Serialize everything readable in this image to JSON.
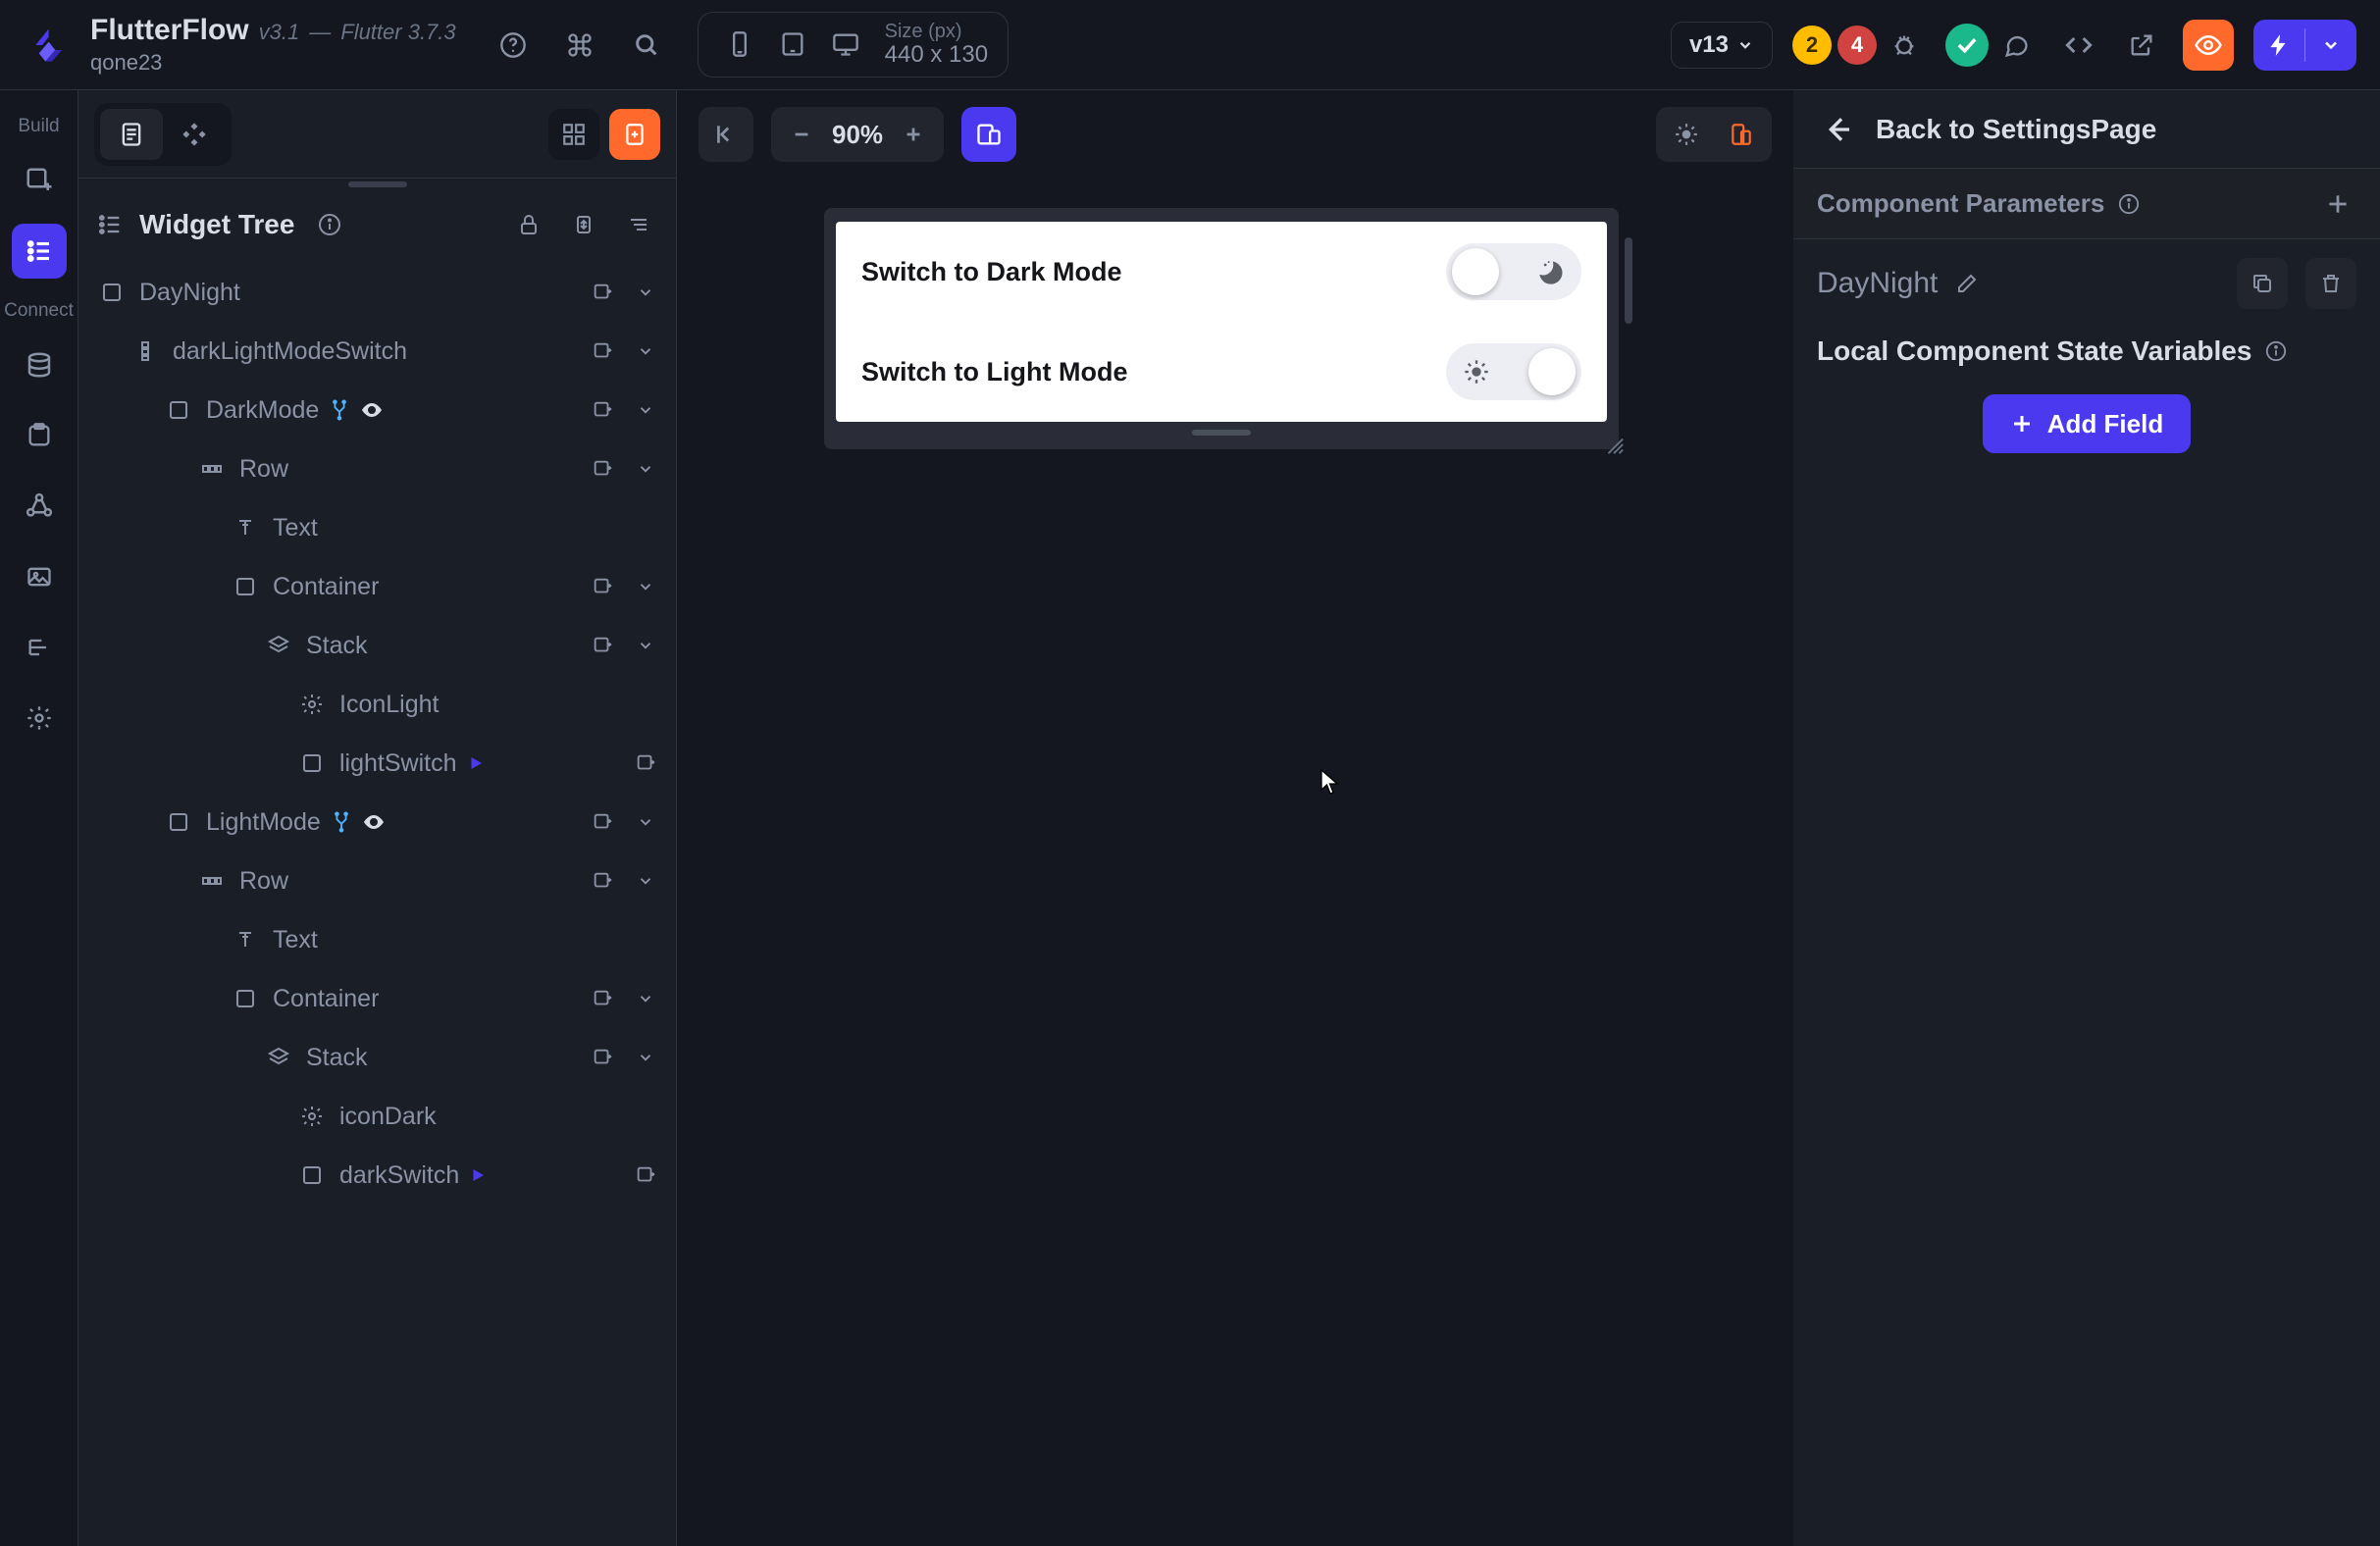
{
  "app": {
    "brand": "FlutterFlow",
    "version": "v3.1",
    "dash": "—",
    "flutter": "Flutter 3.7.3",
    "owner": "qone23"
  },
  "devicebar": {
    "size_label": "Size (px)",
    "size_value": "440 x 130"
  },
  "toolbar_right": {
    "version_pill": "v13",
    "warnings_count": "2",
    "errors_count": "4"
  },
  "rail": {
    "build": "Build",
    "connect": "Connect"
  },
  "widget_tree": {
    "title": "Widget Tree",
    "items": [
      {
        "name": "DayNight",
        "depth": 0,
        "icon": "box",
        "actions": true,
        "chev": true
      },
      {
        "name": "darkLightModeSwitch",
        "depth": 1,
        "icon": "column",
        "actions": true,
        "chev": true
      },
      {
        "name": "DarkMode",
        "depth": 2,
        "icon": "box",
        "cond": true,
        "eye": true,
        "actions": true,
        "chev": true
      },
      {
        "name": "Row",
        "depth": 3,
        "icon": "row",
        "actions": true,
        "chev": true
      },
      {
        "name": "Text",
        "depth": 4,
        "icon": "text"
      },
      {
        "name": "Container",
        "depth": 4,
        "icon": "box",
        "actions": true,
        "chev": true
      },
      {
        "name": "Stack",
        "depth": 5,
        "icon": "stack",
        "actions": true,
        "chev": true
      },
      {
        "name": "IconLight",
        "depth": 6,
        "icon": "gear"
      },
      {
        "name": "lightSwitch",
        "depth": 6,
        "icon": "box",
        "play": true,
        "actions": true
      },
      {
        "name": "LightMode",
        "depth": 2,
        "icon": "box",
        "cond": true,
        "eye": true,
        "actions": true,
        "chev": true
      },
      {
        "name": "Row",
        "depth": 3,
        "icon": "row",
        "actions": true,
        "chev": true
      },
      {
        "name": "Text",
        "depth": 4,
        "icon": "text"
      },
      {
        "name": "Container",
        "depth": 4,
        "icon": "box",
        "actions": true,
        "chev": true
      },
      {
        "name": "Stack",
        "depth": 5,
        "icon": "stack",
        "actions": true,
        "chev": true
      },
      {
        "name": "iconDark",
        "depth": 6,
        "icon": "gear"
      },
      {
        "name": "darkSwitch",
        "depth": 6,
        "icon": "box",
        "play": true,
        "actions": true
      }
    ]
  },
  "canvas": {
    "zoom": "90%",
    "row1": "Switch to Dark Mode",
    "row2": "Switch to Light Mode"
  },
  "rightpanel": {
    "back": "Back to SettingsPage",
    "section": "Component Parameters",
    "component_name": "DayNight",
    "state_title": "Local Component State Variables",
    "add_field": "Add Field"
  }
}
